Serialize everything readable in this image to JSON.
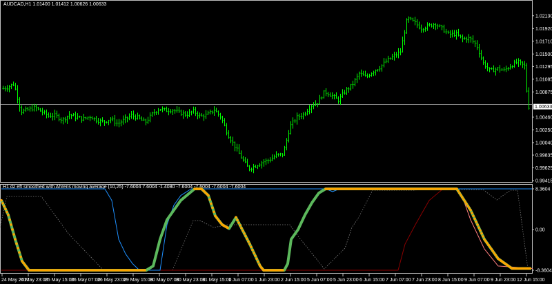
{
  "main_header": "AUDCAD,H1  1.01400 1.01412 1.00626 1.00633",
  "price_axis": [
    "1.02130",
    "1.01920",
    "1.01710",
    "1.01500",
    "1.01295",
    "1.01085",
    "1.00875",
    "1.00633",
    "1.00460",
    "1.00250",
    "1.00040",
    "0.99835",
    "0.99625",
    "0.99415"
  ],
  "current_price": "1.00633",
  "indicator_header": "H1 dz eft smoothed with Ahrens moving average (10,25) -7.6004 7.6004 -1.4080 -7.6004 -7.6004 -7.6004 -7.6004",
  "indicator_axis": [
    "8.3604",
    "0.00",
    "-8.3604"
  ],
  "time_axis": [
    "24 May 2017",
    "24 May 23:00",
    "25 May 15:00",
    "26 May 07:00",
    "26 May 23:00",
    "29 May 15:00",
    "30 May 07:00",
    "30 May 23:00",
    "31 May 15:00",
    "1 Jun 07:00",
    "1 Jun 23:00",
    "2 Jun 15:00",
    "5 Jun 07:00",
    "5 Jun 23:00",
    "6 Jun 15:00",
    "7 Jun 07:00",
    "7 Jun 23:00",
    "8 Jun 15:00",
    "9 Jun 07:00",
    "9 Jun 23:00",
    "12 Jun 15:00"
  ],
  "colors": {
    "background": "#000000",
    "bars": "#00ff00",
    "grid": "#c0c0c0",
    "ahrens_line": "#5cb85c",
    "ahrens_markers": "#ffa500",
    "blue_line": "#1e90ff",
    "red_line": "#8b0000",
    "pink_line": "#ff7f7f",
    "dotted_line": "#808080"
  },
  "chart_data": [
    {
      "type": "line",
      "title": "AUDCAD,H1",
      "series_kind": "ohlc-bars",
      "ylim": [
        0.99415,
        1.0223
      ],
      "x": [
        0,
        10,
        20,
        30,
        40,
        50,
        60,
        70,
        80,
        90,
        100,
        110,
        120,
        130,
        140,
        150,
        160,
        170,
        180,
        190,
        200,
        210,
        220,
        230,
        240,
        250,
        260,
        270,
        280,
        290,
        300,
        310,
        320,
        330,
        340,
        350,
        360,
        370,
        380,
        390,
        400,
        410,
        420,
        430,
        440,
        450,
        460,
        470,
        480,
        490,
        500,
        510,
        520,
        530,
        540,
        550,
        560,
        570,
        580,
        590,
        600,
        610,
        620,
        630,
        640,
        650,
        660,
        670,
        680,
        690,
        700,
        710,
        720,
        730,
        740,
        750,
        760,
        765
      ],
      "close": [
        1.0092,
        1.0095,
        1.0101,
        1.0055,
        1.0058,
        1.0062,
        1.0055,
        1.0048,
        1.0049,
        1.0041,
        1.005,
        1.0046,
        1.0043,
        1.0047,
        1.0041,
        1.0038,
        1.0043,
        1.0035,
        1.0042,
        1.0049,
        1.0045,
        1.0037,
        1.0051,
        1.006,
        1.0057,
        1.0058,
        1.0053,
        1.005,
        1.0056,
        1.0047,
        1.005,
        1.0058,
        1.0046,
        1.0017,
        0.9998,
        0.9978,
        0.9961,
        0.9966,
        0.9972,
        0.9976,
        0.9983,
        0.9985,
        1.0031,
        1.0046,
        1.0051,
        1.0065,
        1.007,
        1.0088,
        1.0082,
        1.0074,
        1.0089,
        1.0099,
        1.0118,
        1.0112,
        1.0121,
        1.0128,
        1.0139,
        1.0146,
        1.0154,
        1.0209,
        1.0202,
        1.0192,
        1.0196,
        1.02,
        1.0192,
        1.0182,
        1.0183,
        1.0175,
        1.0176,
        1.0165,
        1.0135,
        1.0122,
        1.0126,
        1.0123,
        1.0131,
        1.0137,
        1.013,
        1.0063
      ]
    },
    {
      "type": "line",
      "title": "H1 dz eft smoothed with Ahrens moving average (10,25)",
      "ylim": [
        -8.3604,
        8.3604
      ],
      "series": [
        {
          "name": "ahrens",
          "x": [
            0,
            10,
            20,
            30,
            40,
            50,
            60,
            150,
            200,
            210,
            220,
            230,
            240,
            260,
            280,
            290,
            300,
            310,
            320,
            330,
            340,
            360,
            375,
            380,
            410,
            415,
            420,
            430,
            440,
            450,
            460,
            470,
            480,
            490,
            600,
            660,
            680,
            700,
            720,
            740,
            768
          ],
          "values": [
            6.0,
            3.0,
            -2.0,
            -6.5,
            -8.36,
            -8.36,
            -8.36,
            -8.36,
            -8.36,
            -8.36,
            -7.5,
            -2.0,
            2.0,
            6.0,
            8.36,
            8.36,
            7.0,
            2.8,
            1.0,
            0.2,
            2.5,
            -3.0,
            -7.5,
            -8.36,
            -8.36,
            -7.0,
            -2.0,
            0.0,
            3.0,
            5.5,
            7.5,
            8.36,
            8.36,
            8.36,
            8.36,
            8.36,
            4.0,
            -2.0,
            -6.0,
            -8.0,
            -8.0
          ]
        },
        {
          "name": "blue",
          "x": [
            0,
            150,
            160,
            170,
            180,
            190,
            200,
            230,
            240,
            250,
            260,
            275,
            310,
            470,
            480,
            490,
            770
          ],
          "values": [
            8.36,
            8.36,
            6.0,
            -2.0,
            -5.0,
            -7.0,
            -8.36,
            -8.36,
            1.0,
            5.0,
            7.0,
            8.36,
            8.36,
            8.36,
            7.8,
            8.36,
            8.36
          ]
        },
        {
          "name": "red",
          "x": [
            0,
            575,
            585,
            600,
            620,
            640,
            770
          ],
          "values": [
            -8.36,
            -8.36,
            -3.0,
            1.0,
            6.0,
            8.36,
            8.36
          ]
        },
        {
          "name": "pink",
          "x": [
            600,
            660,
            670,
            680,
            700,
            720,
            770
          ],
          "values": [
            8.36,
            8.36,
            6.0,
            2.0,
            -4.0,
            -7.5,
            -8.0
          ]
        }
      ]
    }
  ]
}
